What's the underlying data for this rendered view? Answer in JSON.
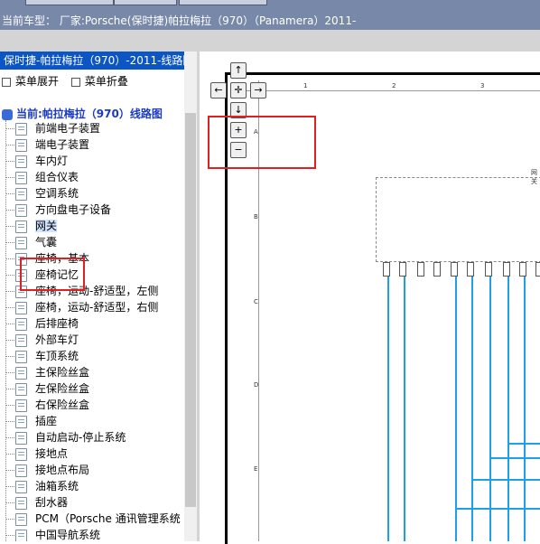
{
  "header": {
    "car_label": "当前车型：  厂家:Porsche(保时捷)帕拉梅拉（970）（Panamera）2011-"
  },
  "left_panel": {
    "title": "保时捷-帕拉梅拉（970）-2011-线路图",
    "expand_label": "菜单展开",
    "collapse_label": "菜单折叠",
    "tree_header": "当前:帕拉梅拉（970）线路图",
    "items": [
      "前端电子装置",
      "端电子装置",
      "车内灯",
      "组合仪表",
      "空调系统",
      "方向盘电子设备",
      "网关",
      "气囊",
      "座椅，基本",
      "座椅记忆",
      "座椅，运动-舒适型，左侧",
      "座椅，运动-舒适型，右侧",
      "后排座椅",
      "外部车灯",
      "车顶系统",
      "主保险丝盒",
      "左保险丝盒",
      "右保险丝盒",
      "插座",
      "自动启动-停止系统",
      "接地点",
      "接地点布局",
      "油箱系统",
      "刮水器",
      "PCM（Porsche 通讯管理系统",
      "中国导航系统"
    ],
    "selected_item": "网关"
  },
  "diagram": {
    "columns": [
      "1",
      "2",
      "3"
    ],
    "rows": [
      "A",
      "B",
      "C",
      "D",
      "E"
    ],
    "nav": {
      "up": "↑",
      "left": "←",
      "center": "✛",
      "right": "→",
      "down": "↓",
      "zoom_in": "+",
      "zoom_out": "−"
    },
    "corner_label": "网关"
  },
  "colors": {
    "topbar": "#7888a8",
    "title_blue": "#0c55c4",
    "wire": "#1ea0e8",
    "highlight": "#e02020"
  }
}
